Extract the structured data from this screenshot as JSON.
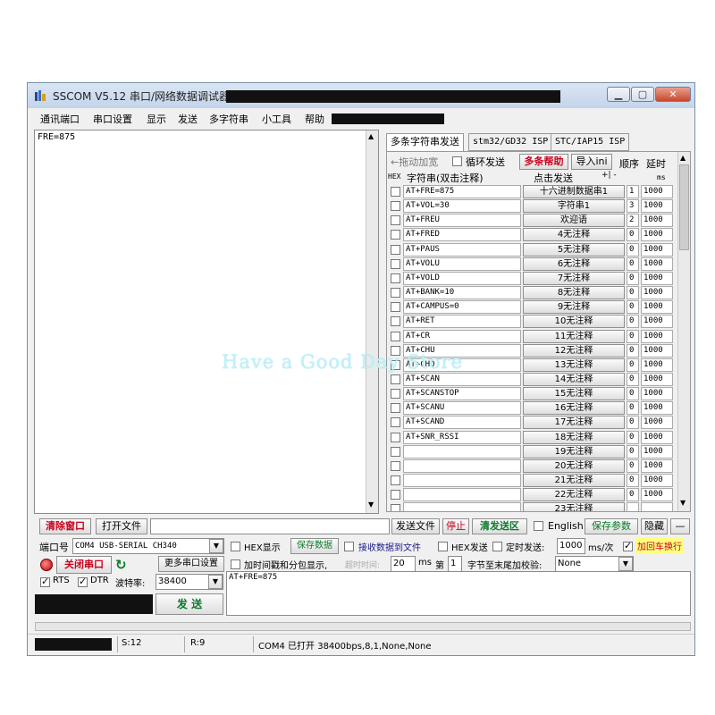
{
  "window": {
    "title": "SSCOM V5.12 串口/网络数据调试器,"
  },
  "menu": [
    "通讯端口",
    "串口设置",
    "显示",
    "发送",
    "多字符串",
    "小工具",
    "帮助"
  ],
  "receive_panel": {
    "text": "FRE=875"
  },
  "tabs": [
    "多条字符串发送",
    "stm32/GD32 ISP",
    "STC/IAP15 ISP"
  ],
  "multi_string": {
    "drag_label": "←拖动加宽",
    "loop_send_label": "循环发送",
    "help_button": "多条帮助",
    "import_button": "导入ini",
    "order_header": "顺序",
    "delay_header": "延时",
    "hex_header": "HEX",
    "string_header": "字符串(双击注释)",
    "click_send_header": "点击发送",
    "plus_minus": "+| -",
    "ms_label": "ms",
    "rows": [
      {
        "cmd": "AT+FRE=875",
        "button": "十六进制数据串1",
        "order": "1",
        "delay": "1000"
      },
      {
        "cmd": "AT+VOL=30",
        "button": "字符串1",
        "order": "3",
        "delay": "1000"
      },
      {
        "cmd": "AT+FREU",
        "button": "欢迎语",
        "order": "2",
        "delay": "1000"
      },
      {
        "cmd": "AT+FRED",
        "button": "4无注释",
        "order": "0",
        "delay": "1000"
      },
      {
        "cmd": "AT+PAUS",
        "button": "5无注释",
        "order": "0",
        "delay": "1000"
      },
      {
        "cmd": "AT+VOLU",
        "button": "6无注释",
        "order": "0",
        "delay": "1000"
      },
      {
        "cmd": "AT+VOLD",
        "button": "7无注释",
        "order": "0",
        "delay": "1000"
      },
      {
        "cmd": "AT+BANK=10",
        "button": "8无注释",
        "order": "0",
        "delay": "1000"
      },
      {
        "cmd": "AT+CAMPUS=0",
        "button": "9无注释",
        "order": "0",
        "delay": "1000"
      },
      {
        "cmd": "AT+RET",
        "button": "10无注释",
        "order": "0",
        "delay": "1000"
      },
      {
        "cmd": "AT+CR",
        "button": "11无注释",
        "order": "0",
        "delay": "1000"
      },
      {
        "cmd": "AT+CHU",
        "button": "12无注释",
        "order": "0",
        "delay": "1000"
      },
      {
        "cmd": "AT+CHD",
        "button": "13无注释",
        "order": "0",
        "delay": "1000"
      },
      {
        "cmd": "AT+SCAN",
        "button": "14无注释",
        "order": "0",
        "delay": "1000"
      },
      {
        "cmd": "AT+SCANSTOP",
        "button": "15无注释",
        "order": "0",
        "delay": "1000"
      },
      {
        "cmd": "AT+SCANU",
        "button": "16无注释",
        "order": "0",
        "delay": "1000"
      },
      {
        "cmd": "AT+SCAND",
        "button": "17无注释",
        "order": "0",
        "delay": "1000"
      },
      {
        "cmd": "AT+SNR_RSSI",
        "button": "18无注释",
        "order": "0",
        "delay": "1000"
      },
      {
        "cmd": "",
        "button": "19无注释",
        "order": "0",
        "delay": "1000"
      },
      {
        "cmd": "",
        "button": "20无注释",
        "order": "0",
        "delay": "1000"
      },
      {
        "cmd": "",
        "button": "21无注释",
        "order": "0",
        "delay": "1000"
      },
      {
        "cmd": "",
        "button": "22无注释",
        "order": "0",
        "delay": "1000"
      },
      {
        "cmd": "",
        "button": "23无注释",
        "order": "",
        "delay": ""
      }
    ]
  },
  "watermark": "Have a Good Day Store",
  "toolbar": {
    "clear_window": "清除窗口",
    "open_file": "打开文件",
    "send_file": "发送文件",
    "stop": "停止",
    "clear_send": "清发送区",
    "english": "English",
    "save_params": "保存参数",
    "hide": "隐藏",
    "minus": "—"
  },
  "port": {
    "port_label": "端口号",
    "port_value": "COM4 USB-SERIAL CH340",
    "close_port": "关闭串口",
    "more_settings": "更多串口设置",
    "rts": "RTS",
    "dtr": "DTR",
    "baud_label": "波特率:",
    "baud_value": "38400"
  },
  "options": {
    "hex_display": "HEX显示",
    "save_data": "保存数据",
    "recv_to_file": "接收数据到文件",
    "hex_send": "HEX发送",
    "timed_send": "定时发送:",
    "timed_value": "1000",
    "ms_per": "ms/次",
    "add_crlf": "加回车换行",
    "timestamp": "加时间戳和分包显示,",
    "timeout_label": "超时时间:",
    "timeout_value": "20",
    "ms": "ms",
    "page_label": "第",
    "page_value": "1",
    "checksum_label": "字节至末尾加校验:",
    "checksum_value": "None"
  },
  "send": {
    "text": "AT+FRE=875",
    "send_button": "发  送"
  },
  "status": {
    "sent": "S:12",
    "received": "R:9",
    "port_status": "COM4 已打开  38400bps,8,1,None,None"
  },
  "colors": {
    "title_bg": "#c3d4ea",
    "red_text": "#c8001e",
    "green_text": "#0b7a2a",
    "highlight_yellow": "#ffff80"
  }
}
